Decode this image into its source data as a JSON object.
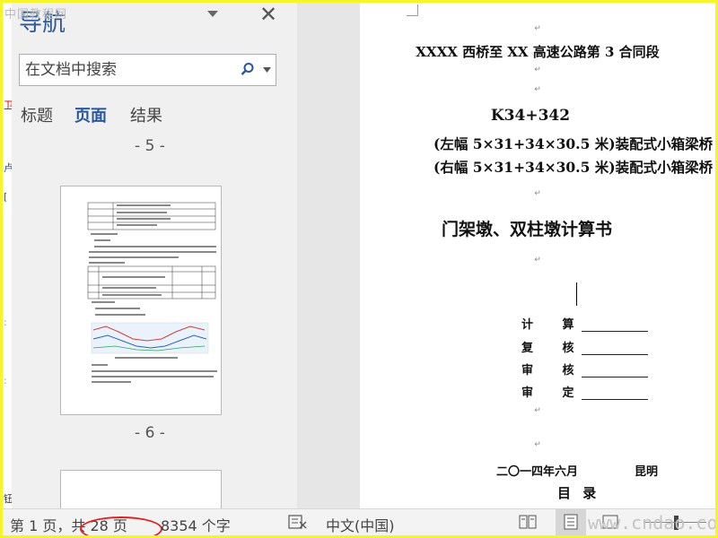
{
  "watermark_top": "中国教程网",
  "nav": {
    "title": "导航",
    "search": {
      "placeholder": "在文档中搜索"
    },
    "tabs": [
      {
        "label": "标题"
      },
      {
        "label": "页面"
      },
      {
        "label": "结果"
      }
    ],
    "page_labels": [
      "- 5 -",
      "- 6 -"
    ]
  },
  "document": {
    "line1": "XXXX 西桥至 XX 高速公路第 3 合同段",
    "line2": "K34+342",
    "line3": "(左幅 5×31+34×30.5 米)装配式小箱梁桥",
    "line4": "(右幅 5×31+34×30.5 米)装配式小箱梁桥",
    "line5": "门架墩、双柱墩计算书",
    "signatures": [
      "计 算",
      "复 核",
      "审 核",
      "审 定"
    ],
    "date": "二〇一四年六月",
    "place": "昆明",
    "toc": "目 录",
    "para_mark": "↵"
  },
  "status_bar": {
    "page_info": "第 1 页，共 28 页",
    "word_count": "8354 个字",
    "language": "中文(中国)"
  },
  "watermark": "www.cndao.com",
  "colors": {
    "accent": "#2b579a",
    "frame": "#f5f52a",
    "highlight": "#e02020"
  },
  "icons": [
    "dropdown-arrow-icon",
    "close-icon",
    "search-icon",
    "proofing-icon",
    "read-mode-icon",
    "print-layout-icon",
    "web-layout-icon"
  ]
}
